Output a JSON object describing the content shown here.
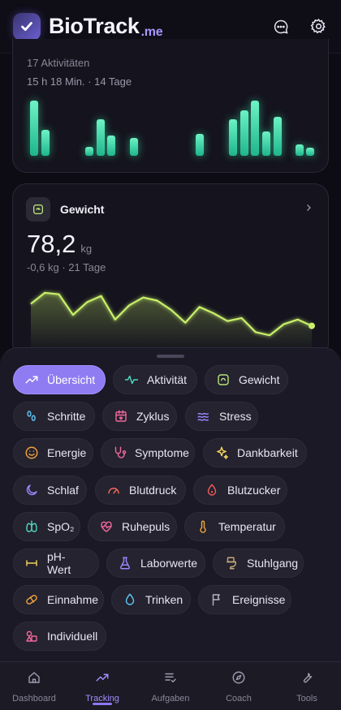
{
  "app": {
    "name": "BioTrack",
    "suffix": ".me"
  },
  "activity_card": {
    "count": "17 Aktivitäten",
    "summary": "15 h 18 Min. · 14 Tage",
    "bars": [
      0.95,
      0.45,
      0,
      0,
      0,
      0.15,
      0.62,
      0.35,
      0,
      0.3,
      0,
      0,
      0,
      0,
      0,
      0.38,
      0,
      0,
      0.62,
      0.78,
      0.94,
      0.42,
      0.66,
      0,
      0.2,
      0.14
    ]
  },
  "weight_card": {
    "title": "Gewicht",
    "value": "78,2",
    "unit": "kg",
    "delta": "-0,6 kg · 21 Tage",
    "chart_data": {
      "type": "area",
      "series": [
        {
          "values": [
            79.4,
            80.1,
            80.0,
            78.7,
            79.5,
            79.9,
            78.4,
            79.3,
            79.8,
            79.6,
            79.0,
            78.2,
            79.2,
            78.8,
            78.3,
            78.5,
            77.6,
            77.4,
            78.1,
            78.4,
            78.0
          ]
        }
      ]
    }
  },
  "categories": [
    {
      "label": "Übersicht",
      "icon": "trend-up-icon",
      "color": "#ffffff",
      "active": true
    },
    {
      "label": "Aktivität",
      "icon": "pulse-icon",
      "color": "#4fd6c0"
    },
    {
      "label": "Gewicht",
      "icon": "scale-icon",
      "color": "#b9e07a"
    },
    {
      "label": "Schritte",
      "icon": "footsteps-icon",
      "color": "#5ec7f5"
    },
    {
      "label": "Zyklus",
      "icon": "calendar-icon",
      "color": "#f0679a"
    },
    {
      "label": "Stress",
      "icon": "waves-icon",
      "color": "#9a86ff"
    },
    {
      "label": "Energie",
      "icon": "smiley-icon",
      "color": "#f2a23c"
    },
    {
      "label": "Symptome",
      "icon": "stethoscope-icon",
      "color": "#f0679a"
    },
    {
      "label": "Dankbarkeit",
      "icon": "sparkles-icon",
      "color": "#f5d25c"
    },
    {
      "label": "Schlaf",
      "icon": "moon-icon",
      "color": "#9a86ff"
    },
    {
      "label": "Blutdruck",
      "icon": "gauge-icon",
      "color": "#f26a5a"
    },
    {
      "label": "Blutzucker",
      "icon": "drop-icon",
      "color": "#f05a5a"
    },
    {
      "label": "SpO₂",
      "icon": "lungs-icon",
      "color": "#4fd6c0"
    },
    {
      "label": "Ruhepuls",
      "icon": "heart-pulse-icon",
      "color": "#f0679a"
    },
    {
      "label": "Temperatur",
      "icon": "thermometer-icon",
      "color": "#f2a23c"
    },
    {
      "label": "pH-Wert",
      "icon": "ph-icon",
      "color": "#f5d25c"
    },
    {
      "label": "Laborwerte",
      "icon": "flask-icon",
      "color": "#9a86ff"
    },
    {
      "label": "Stuhlgang",
      "icon": "toilet-icon",
      "color": "#c9a97a"
    },
    {
      "label": "Einnahme",
      "icon": "pill-icon",
      "color": "#f2a23c"
    },
    {
      "label": "Trinken",
      "icon": "water-drop-icon",
      "color": "#5ec7f5"
    },
    {
      "label": "Ereignisse",
      "icon": "flag-icon",
      "color": "#b7b4c4"
    },
    {
      "label": "Individuell",
      "icon": "shapes-icon",
      "color": "#f0679a"
    }
  ],
  "nav": [
    {
      "label": "Dashboard",
      "icon": "home-icon"
    },
    {
      "label": "Tracking",
      "icon": "trend-up-icon",
      "active": true
    },
    {
      "label": "Aufgaben",
      "icon": "checklist-icon"
    },
    {
      "label": "Coach",
      "icon": "compass-icon"
    },
    {
      "label": "Tools",
      "icon": "wrench-icon"
    }
  ]
}
